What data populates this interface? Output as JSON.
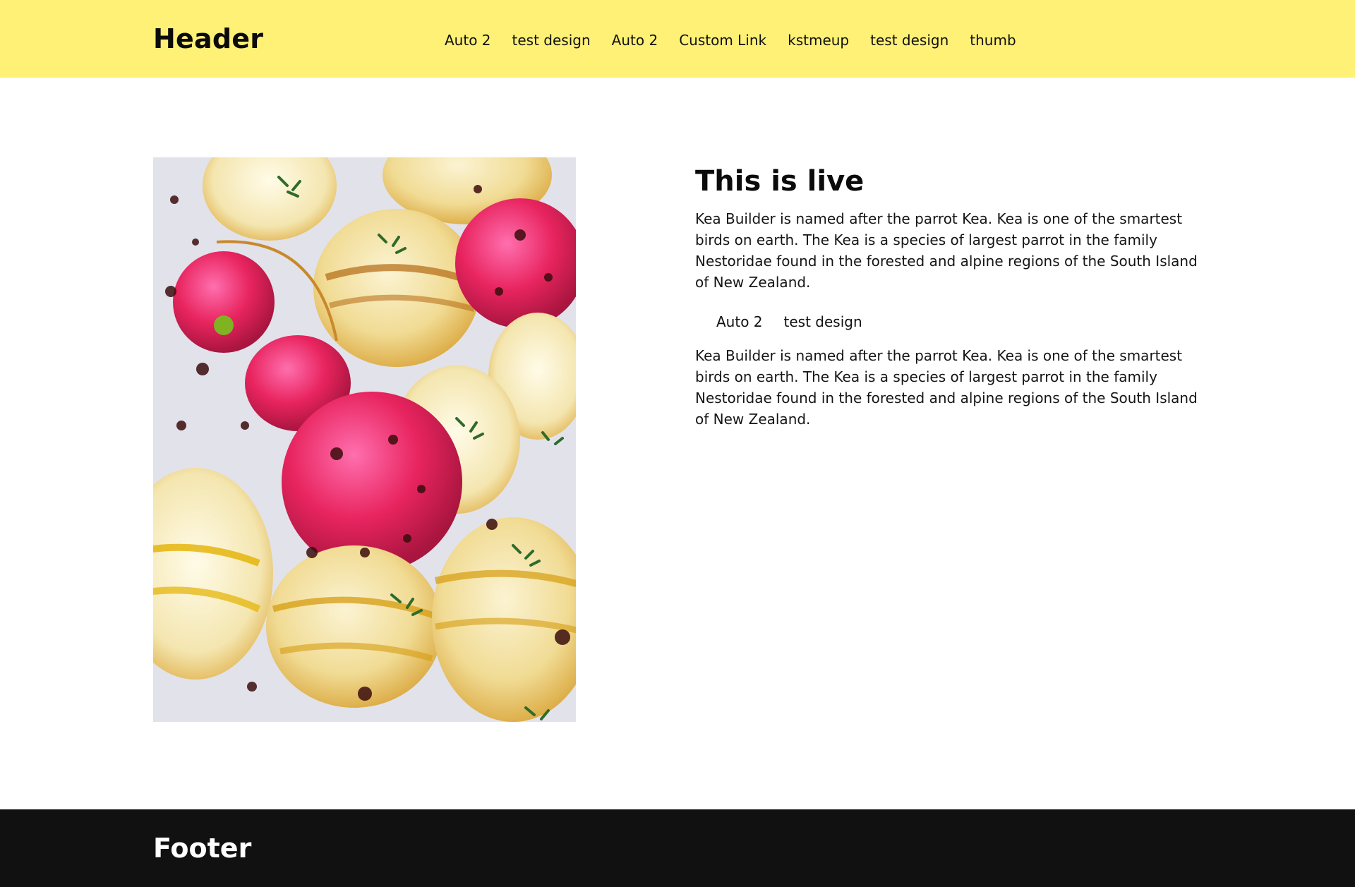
{
  "header": {
    "brand": "Header",
    "nav": [
      "Auto 2",
      "test design",
      "Auto 2",
      "Custom Link",
      "kstmeup",
      "test design",
      "thumb"
    ]
  },
  "main": {
    "image_alt": "Roasted radishes and turnips with thyme and balsamic glaze",
    "title": "This is live",
    "paragraph_1": "Kea Builder is named after the parrot Kea. Kea is one of the smartest birds on earth. The Kea is a species of largest parrot in the family Nestoridae found in the forested and alpine regions of the South Island of New Zealand.",
    "links": [
      "Auto 2",
      "test design"
    ],
    "paragraph_2": "Kea Builder is named after the parrot Kea. Kea is one of the smartest birds on earth. The Kea is a species of largest parrot in the family Nestoridae found in the forested and alpine regions of the South Island of New Zealand."
  },
  "footer": {
    "brand": "Footer"
  },
  "colors": {
    "header_bg": "#fff176",
    "footer_bg": "#111111",
    "text": "#111111"
  }
}
